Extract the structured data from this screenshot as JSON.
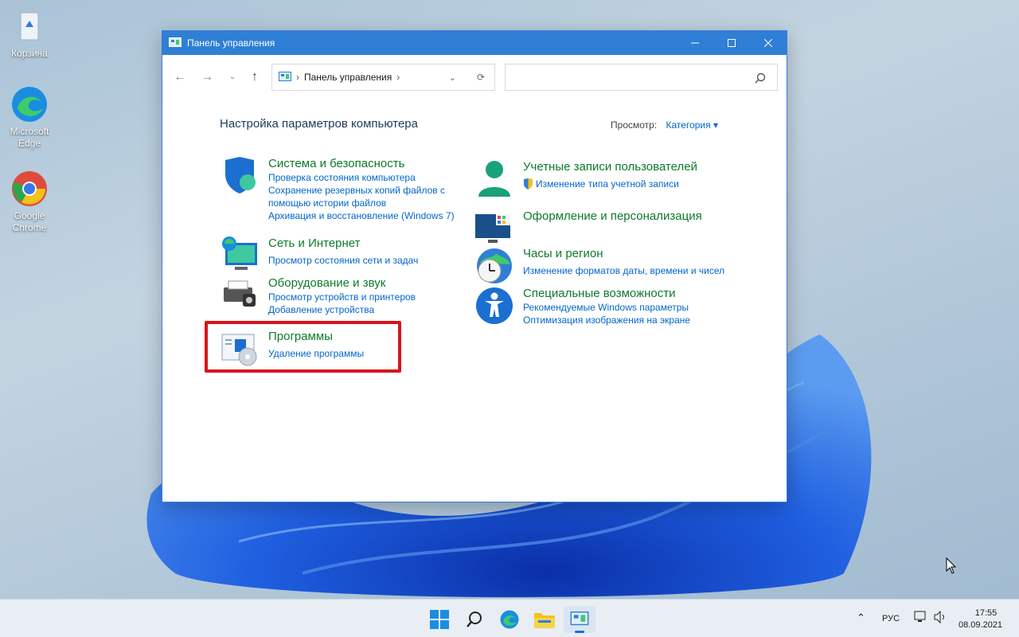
{
  "desktop": {
    "icons": [
      {
        "label": "Корзина"
      },
      {
        "label": "Microsoft Edge"
      },
      {
        "label": "Google Chrome"
      }
    ]
  },
  "window": {
    "title": "Панель управления",
    "breadcrumb": "Панель управления",
    "heading": "Настройка параметров компьютера",
    "view_by_label": "Просмотр:",
    "view_by_value": "Категория",
    "categories_left": [
      {
        "title": "Система и безопасность",
        "links": [
          "Проверка состояния компьютера",
          "Сохранение резервных копий файлов с",
          "помощью истории файлов",
          "Архивация и восстановление (Windows 7)"
        ]
      },
      {
        "title": "Сеть и Интернет",
        "links": [
          "Просмотр состояния сети и задач"
        ]
      },
      {
        "title": "Оборудование и звук",
        "links": [
          "Просмотр устройств и принтеров",
          "Добавление устройства"
        ]
      },
      {
        "title": "Программы",
        "links": [
          "Удаление программы"
        ]
      }
    ],
    "categories_right": [
      {
        "title": "Учетные записи пользователей",
        "links": [
          "Изменение типа учетной записи"
        ]
      },
      {
        "title": "Оформление и персонализация",
        "links": []
      },
      {
        "title": "Часы и регион",
        "links": [
          "Изменение форматов даты, времени и чисел"
        ]
      },
      {
        "title": "Специальные возможности",
        "links": [
          "Рекомендуемые Windows параметры",
          "Оптимизация изображения на экране"
        ]
      }
    ]
  },
  "taskbar": {
    "language": "РУС",
    "time": "17:55",
    "date": "08.09.2021"
  },
  "colors": {
    "accent": "#2f7fd6",
    "category_title": "#0d7a2a",
    "link": "#0066cc",
    "highlight": "#d8141b"
  }
}
